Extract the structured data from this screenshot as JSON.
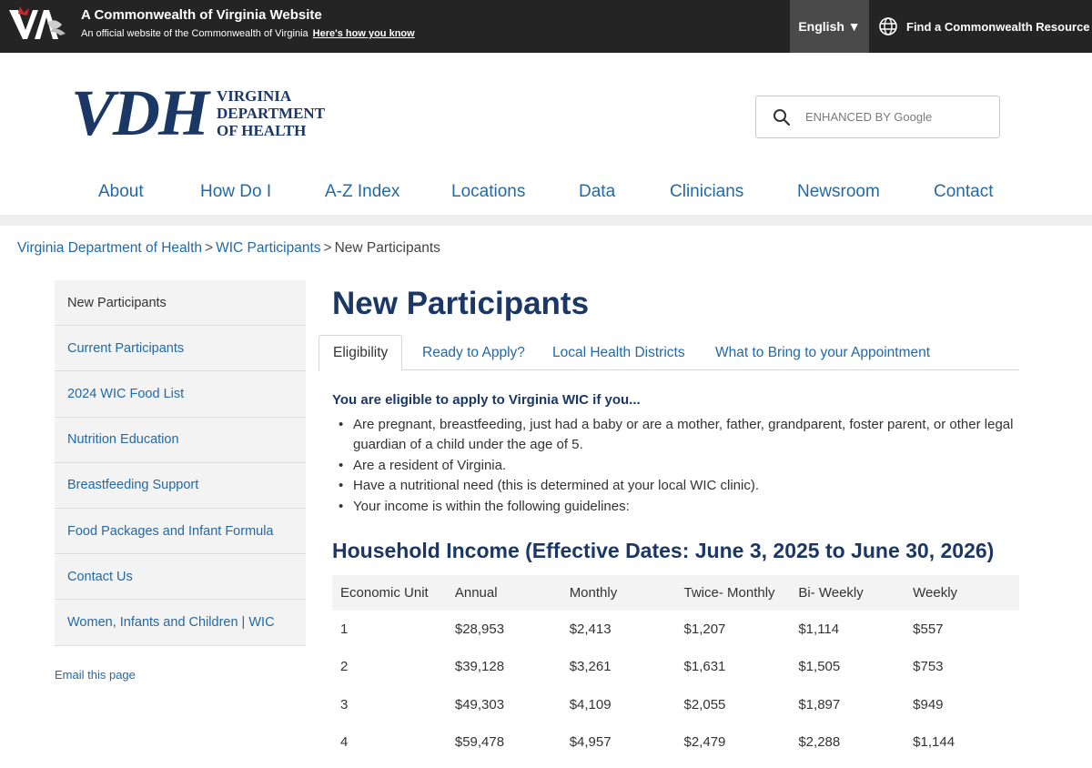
{
  "banner": {
    "title": "A Commonwealth of Virginia Website",
    "subtitle": "An official website of the Commonwealth of Virginia",
    "how_link": "Here's how you know",
    "language": "English ▼",
    "resource": "Find a Commonwealth Resource"
  },
  "header": {
    "logo_letters": "VDH",
    "logo_line1": "VIRGINIA",
    "logo_line2": "DEPARTMENT",
    "logo_line3": "OF HEALTH",
    "search_placeholder": "ENHANCED BY Google"
  },
  "nav": {
    "items": [
      "About",
      "How Do I",
      "A-Z Index",
      "Locations",
      "Data",
      "Clinicians",
      "Newsroom",
      "Contact"
    ]
  },
  "breadcrumb": {
    "home": "Virginia Department of Health",
    "section": "WIC Participants",
    "current": "New Participants",
    "sep": ">"
  },
  "sidebar": {
    "items": [
      "New Participants",
      "Current Participants",
      "2024 WIC Food List",
      "Nutrition Education",
      "Breastfeeding Support",
      "Food Packages and Infant Formula",
      "Contact Us",
      "Women, Infants and Children | WIC"
    ],
    "email": "Email this page"
  },
  "content": {
    "title": "New Participants",
    "tabs": [
      "Eligibility",
      "Ready to Apply?",
      "Local Health Districts",
      "What to Bring to your Appointment"
    ],
    "elig_heading": "You are eligible to apply to Virginia WIC if you...",
    "elig_items": [
      "Are pregnant, breastfeeding, just had a baby or are a mother, father, grandparent, foster parent, or other legal guardian of a child under the age of 5.",
      "Are a resident of Virginia.",
      "Have a nutritional need (this is determined at your local WIC clinic).",
      "Your income is within the following guidelines:"
    ],
    "hh_title": "Household Income",
    "hh_dates": "(Effective Dates: June 3, 2025 to June 30, 2026)"
  },
  "table": {
    "headers": [
      "Economic Unit",
      "Annual",
      "Monthly",
      "Twice- Monthly",
      "Bi- Weekly",
      "Weekly"
    ],
    "rows": [
      [
        "1",
        "$28,953",
        "$2,413",
        "$1,207",
        "$1,114",
        "$557"
      ],
      [
        "2",
        "$39,128",
        "$3,261",
        "$1,631",
        "$1,505",
        "$753"
      ],
      [
        "3",
        "$49,303",
        "$4,109",
        "$2,055",
        "$1,897",
        "$949"
      ],
      [
        "4",
        "$59,478",
        "$4,957",
        "$2,479",
        "$2,288",
        "$1,144"
      ]
    ]
  }
}
